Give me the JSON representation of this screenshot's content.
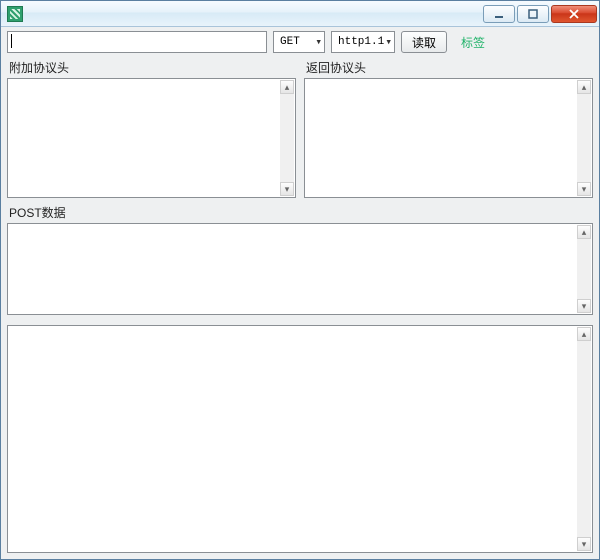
{
  "window": {
    "title": ""
  },
  "toolbar": {
    "url_value": "",
    "method_selected": "GET",
    "http_selected": "http1.1",
    "read_label": "读取",
    "tag_label": "标签"
  },
  "sections": {
    "attach_header_label": "附加协议头",
    "return_header_label": "返回协议头",
    "post_data_label": "POST数据"
  }
}
